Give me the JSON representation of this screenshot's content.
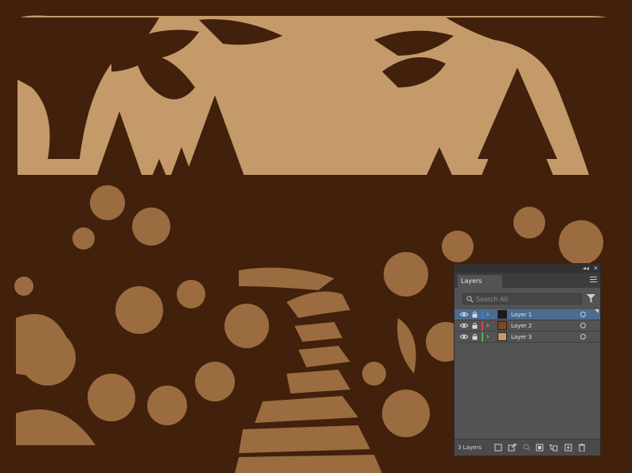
{
  "colors": {
    "paper_dark": "#41200c",
    "paper_light": "#c59a6a",
    "mid_brown": "#9b6c3f",
    "panel_bg": "#535353",
    "selection": "#4b6c8f"
  },
  "layers_panel": {
    "title_controls": {
      "collapse": "◂◂",
      "close": "✕"
    },
    "tab_label": "Layers",
    "menu_icon": "hamburger-menu-icon",
    "search": {
      "placeholder": "Search All",
      "icon": "search-icon"
    },
    "filter_icon": "filter-icon",
    "layers": [
      {
        "name": "Layer 1",
        "color": "#3d7bd6",
        "selected": true
      },
      {
        "name": "Layer 2",
        "color": "#d94040",
        "selected": false
      },
      {
        "name": "Layer 3",
        "color": "#3fbf4a",
        "selected": false
      }
    ],
    "footer": {
      "count_label": "3 Layers",
      "icons": [
        "collect-for-export-icon",
        "export-icon",
        "locate-object-icon",
        "make-clipping-mask-icon",
        "create-sublayer-icon",
        "create-new-layer-icon",
        "delete-icon"
      ]
    }
  }
}
